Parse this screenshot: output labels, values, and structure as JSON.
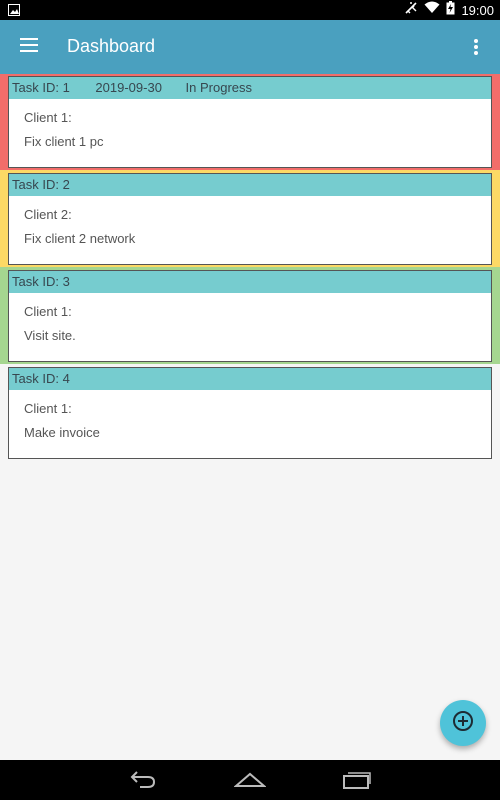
{
  "status_bar": {
    "time": "19:00"
  },
  "app_bar": {
    "title": "Dashboard"
  },
  "tasks": [
    {
      "id_label": "Task ID: 1",
      "date": "2019-09-30",
      "status": "In Progress",
      "client": "Client 1:",
      "description": "Fix client 1 pc",
      "color": "#f26d6a"
    },
    {
      "id_label": "Task ID: 2",
      "date": "",
      "status": "",
      "client": "Client 2:",
      "description": "Fix client 2 network",
      "color": "#fcd965"
    },
    {
      "id_label": "Task ID: 3",
      "date": "",
      "status": "",
      "client": "Client 1:",
      "description": "Visit site.",
      "color": "#a5d690"
    },
    {
      "id_label": "Task ID: 4",
      "date": "",
      "status": "",
      "client": "Client 1:",
      "description": "Make invoice",
      "color": ""
    }
  ],
  "colors": {
    "app_bar": "#4aa0bf",
    "card_header": "#76cccf",
    "fab": "#4fc3d9"
  },
  "icons": {
    "menu": "menu-icon",
    "overflow": "more-vert-icon",
    "fab": "add-circle-icon",
    "nav_back": "back-icon",
    "nav_home": "home-icon",
    "nav_recents": "recents-icon"
  }
}
